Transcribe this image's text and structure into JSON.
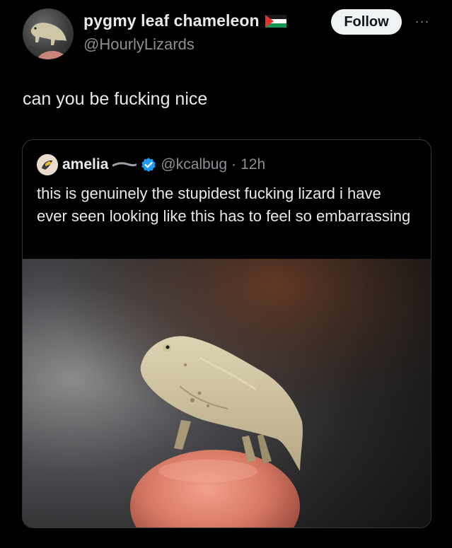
{
  "author": {
    "display_name": "pygmy leaf chameleon",
    "handle": "@HourlyLizards",
    "avatar_icon": "chameleon-avatar-icon",
    "flag_icon": "palestine-flag-icon"
  },
  "actions": {
    "follow_label": "Follow",
    "more_label": "···"
  },
  "tweet": {
    "text": "can you be fucking nice"
  },
  "quoted": {
    "display_name": "amelia",
    "handle": "@kcalbug",
    "separator": "·",
    "time": "12h",
    "text": "this is genuinely the stupidest fucking lizard i have ever seen looking like this has to feel so embarrassing",
    "verified_icon": "verified-badge-icon",
    "photo_icon": "chameleon-on-fingertip-photo"
  },
  "colors": {
    "background": "#000000",
    "text": "#e7e9ea",
    "secondary": "#8b8f94",
    "border": "#333639",
    "verified": "#1d9bf0",
    "follow_bg": "#eff3f4"
  }
}
